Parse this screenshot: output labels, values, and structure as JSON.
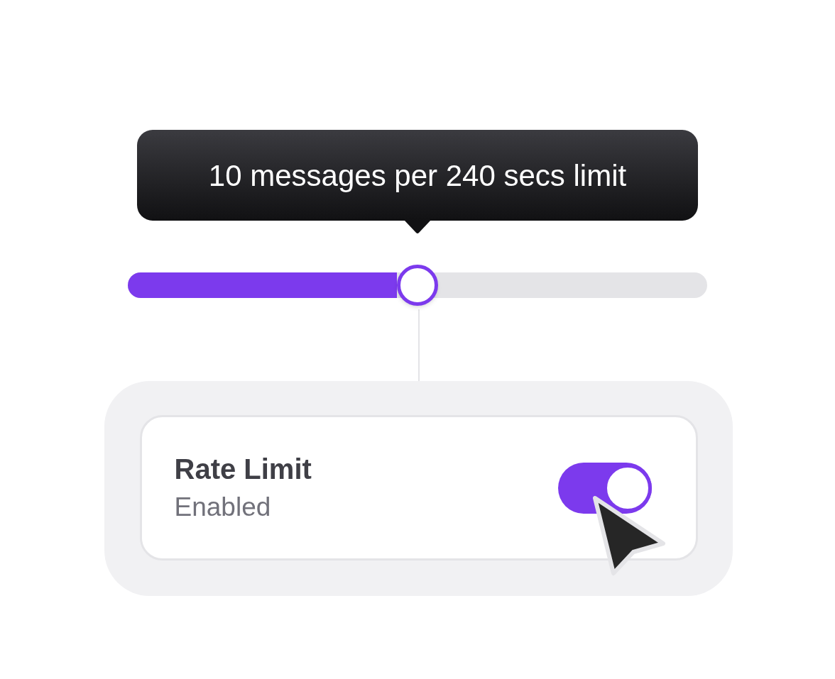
{
  "tooltip": {
    "text": "10 messages per 240 secs limit"
  },
  "slider": {
    "level": 0.5
  },
  "setting": {
    "title": "Rate Limit",
    "status": "Enabled",
    "on": true
  }
}
